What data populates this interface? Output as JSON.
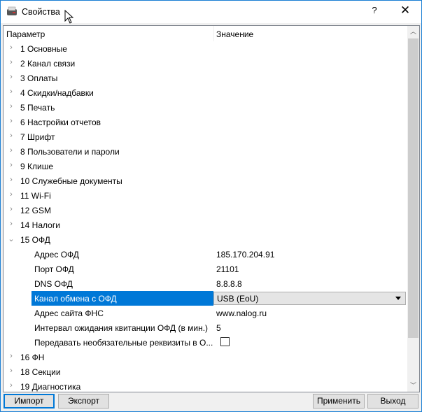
{
  "window": {
    "title": "Свойства",
    "help": "?",
    "close": "✕"
  },
  "header": {
    "param": "Параметр",
    "value": "Значение"
  },
  "rows": [
    {
      "label": "1 Основные",
      "expanded": false
    },
    {
      "label": "2 Канал связи",
      "expanded": false
    },
    {
      "label": "3 Оплаты",
      "expanded": false
    },
    {
      "label": "4 Скидки/надбавки",
      "expanded": false
    },
    {
      "label": "5 Печать",
      "expanded": false
    },
    {
      "label": "6 Настройки отчетов",
      "expanded": false
    },
    {
      "label": "7 Шрифт",
      "expanded": false
    },
    {
      "label": "8 Пользователи и пароли",
      "expanded": false
    },
    {
      "label": "9 Клише",
      "expanded": false
    },
    {
      "label": "10 Служебные документы",
      "expanded": false
    },
    {
      "label": "11 Wi-Fi",
      "expanded": false
    },
    {
      "label": "12 GSM",
      "expanded": false
    },
    {
      "label": "14 Налоги",
      "expanded": false
    },
    {
      "label": "15 ОФД",
      "expanded": true
    }
  ],
  "ofd": [
    {
      "label": "Адрес ОФД",
      "value": "185.170.204.91"
    },
    {
      "label": "Порт ОФД",
      "value": "21101"
    },
    {
      "label": "DNS ОФД",
      "value": "8.8.8.8"
    },
    {
      "label": "Канал обмена с ОФД",
      "value": "USB (EoU)",
      "selected": true
    },
    {
      "label": "Адрес сайта ФНС",
      "value": "www.nalog.ru"
    },
    {
      "label": "Интервал ожидания квитанции ОФД (в мин.)",
      "value": "5"
    },
    {
      "label": "Передавать необязательные реквизиты в О...",
      "checked": false
    }
  ],
  "rows_after": [
    {
      "label": "16 ФН"
    },
    {
      "label": "18 Секции"
    },
    {
      "label": "19 Диагностика"
    }
  ],
  "buttons": {
    "import": "Импорт",
    "export": "Экспорт",
    "apply": "Применить",
    "exit": "Выход"
  },
  "icons": {
    "expand": "›",
    "collapse": "⌄",
    "scroll_up": "︿",
    "scroll_down": "﹀"
  }
}
